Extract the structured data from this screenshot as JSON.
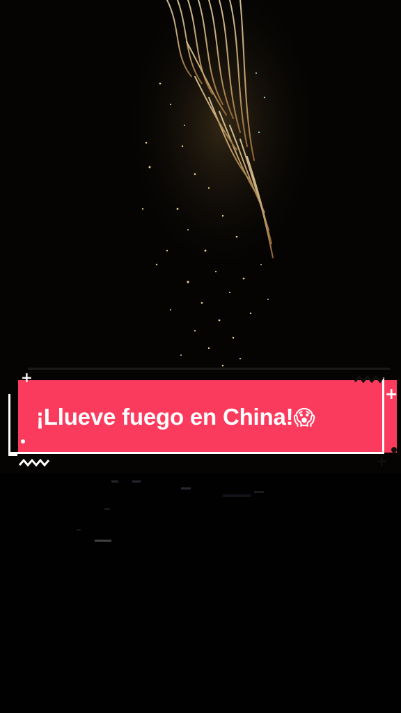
{
  "video": {
    "caption_text": "¡Llueve fuego en China!",
    "caption_emoji": "😱",
    "caption_emoji_name": "face-screaming-in-fear",
    "colors": {
      "banner": "#fb3b5d",
      "caption_text": "#ffffff",
      "night_sky": "#050403",
      "sparks": "#e8c98a"
    }
  }
}
